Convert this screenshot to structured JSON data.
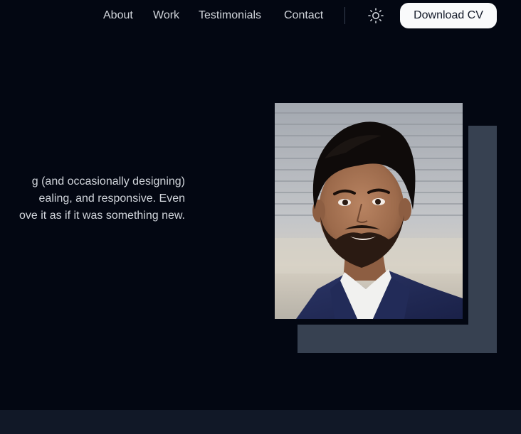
{
  "nav": {
    "links": [
      {
        "label": "About"
      },
      {
        "label": "Work"
      },
      {
        "label": "Testimonials"
      },
      {
        "label": "Contact"
      }
    ],
    "theme_toggle_icon": "sun-icon",
    "cta_label": "Download CV"
  },
  "hero": {
    "description_lines": [
      "g (and occasionally designing)",
      "ealing, and responsive. Even",
      "ove it as if it was something new."
    ]
  },
  "portrait": {
    "subject": "profile-photo"
  },
  "colors": {
    "background": "#030712",
    "text": "#d1d5db",
    "accent_block": "#374151",
    "button_bg": "#f9fafb",
    "footer_band": "#111827"
  }
}
